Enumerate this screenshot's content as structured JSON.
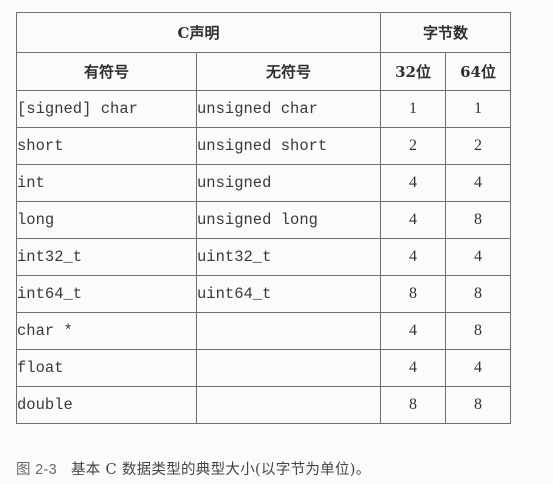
{
  "table": {
    "header_group_decl": "C声明",
    "header_group_bytes": "字节数",
    "header_signed": "有符号",
    "header_unsigned": "无符号",
    "header_32": "32位",
    "header_64": "64位",
    "rows": [
      {
        "signed": "[signed] char",
        "unsigned": "unsigned char",
        "b32": "1",
        "b64": "1"
      },
      {
        "signed": "short",
        "unsigned": "unsigned short",
        "b32": "2",
        "b64": "2"
      },
      {
        "signed": "int",
        "unsigned": "unsigned",
        "b32": "4",
        "b64": "4"
      },
      {
        "signed": "long",
        "unsigned": "unsigned long",
        "b32": "4",
        "b64": "8"
      },
      {
        "signed": "int32_t",
        "unsigned": "uint32_t",
        "b32": "4",
        "b64": "4"
      },
      {
        "signed": "int64_t",
        "unsigned": "uint64_t",
        "b32": "8",
        "b64": "8"
      },
      {
        "signed": "char *",
        "unsigned": "",
        "b32": "4",
        "b64": "8"
      },
      {
        "signed": "float",
        "unsigned": "",
        "b32": "4",
        "b64": "4"
      },
      {
        "signed": "double",
        "unsigned": "",
        "b32": "8",
        "b64": "8"
      }
    ]
  },
  "caption": {
    "label": "图 2-3",
    "text": "基本 C 数据类型的典型大小(以字节为单位)。"
  }
}
